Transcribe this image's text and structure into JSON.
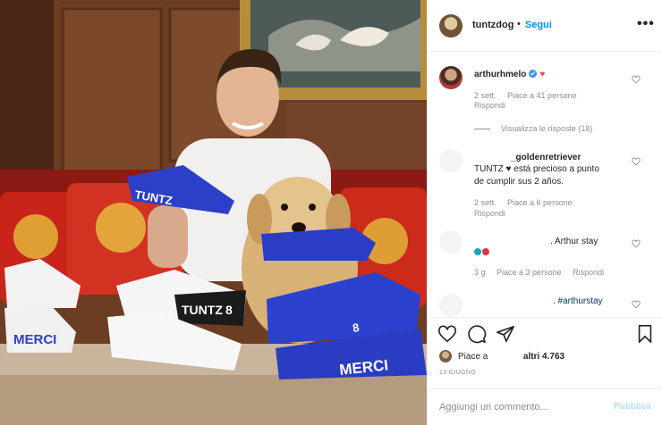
{
  "post": {
    "author": "tuntzdog",
    "follow_label": "Segui",
    "dot": "•",
    "more": "•••"
  },
  "comments": [
    {
      "user": "arthurhmelo",
      "verified": true,
      "text_suffix": "♥",
      "time": "2 sett.",
      "likes": "Piace a 41 persone",
      "reply": "Rispondi",
      "view_replies": "Visualizza le risposte (18)"
    },
    {
      "user": "_goldenretriever",
      "text_lines": [
        "TUNTZ ♥ está precioso a punto",
        "de cumplir sus 2 años."
      ],
      "time": "2 sett.",
      "likes": "Piace a 6 persone",
      "reply": "Rispondi"
    },
    {
      "text": ". Arthur stay",
      "time": "3 g",
      "likes": "Piace a 3 persone",
      "reply": "Rispondi"
    },
    {
      "text": ". #arthurstay"
    }
  ],
  "likes": {
    "prefix": "Piace a",
    "suffix": "altri 4.763"
  },
  "date": "13 GIUGNO",
  "add_comment": {
    "placeholder": "Aggiungi un commento...",
    "publish": "Pubblica"
  },
  "icons": {
    "like": "heart-outline-icon",
    "comment": "comment-bubble-icon",
    "share": "paper-plane-icon",
    "save": "bookmark-icon",
    "more": "ellipsis-icon",
    "verified": "verified-badge-icon"
  },
  "colors": {
    "link": "#0095f6",
    "meta": "#8e8e8e",
    "verified": "#3897f0",
    "heart": "#ed4956",
    "publish_disabled": "#b2dffc",
    "boots": "#2c3fc8"
  },
  "photo": {
    "boot_labels": [
      "TUNTZ",
      "8",
      "MERCI",
      "TUNTZ",
      "8",
      "MERCI"
    ]
  }
}
